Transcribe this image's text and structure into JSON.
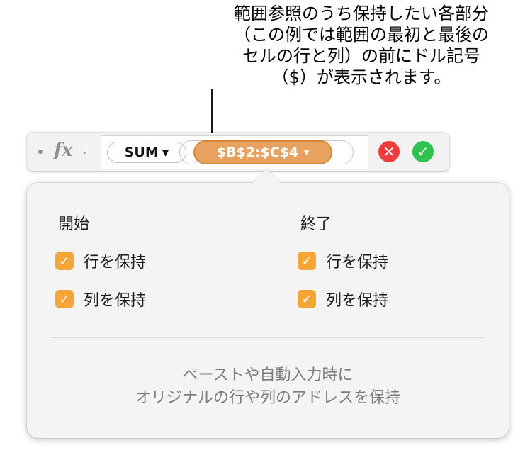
{
  "callout": {
    "lines": [
      "範囲参照のうち保持したい各部分",
      "（この例では範囲の最初と最後の",
      "セルの行と列）の前にドル記号",
      "（$）が表示されます。"
    ]
  },
  "formula_bar": {
    "fx_label": "fx",
    "function_token": "SUM",
    "function_chevron": "▾",
    "range_token": "$B$2:$C$4",
    "range_chevron": "▾",
    "cancel_icon": "✕",
    "accept_icon": "✓",
    "colors": {
      "range_token": "#e8a25f",
      "cancel": "#ee3b3b",
      "accept": "#2fc24e"
    }
  },
  "popover": {
    "start": {
      "title": "開始",
      "keep_row": {
        "label": "行を保持",
        "checked": true
      },
      "keep_column": {
        "label": "列を保持",
        "checked": true
      }
    },
    "end": {
      "title": "終了",
      "keep_row": {
        "label": "行を保持",
        "checked": true
      },
      "keep_column": {
        "label": "列を保持",
        "checked": true
      }
    },
    "footer_lines": [
      "ペーストや自動入力時に",
      "オリジナルの行や列のアドレスを保持"
    ],
    "checkbox_color": "#f4a536"
  }
}
